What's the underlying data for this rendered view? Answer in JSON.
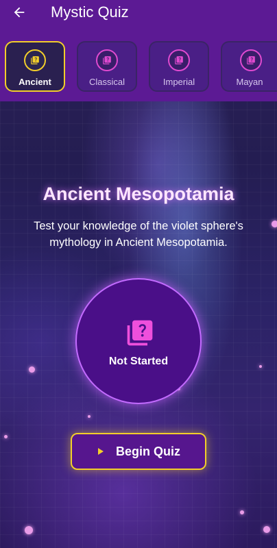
{
  "app": {
    "title": "Mystic Quiz"
  },
  "header": {
    "back_icon": "back-arrow-icon"
  },
  "tabs": [
    {
      "label": "Ancient",
      "icon": "quiz-icon",
      "active": true
    },
    {
      "label": "Classical",
      "icon": "quiz-icon",
      "active": false
    },
    {
      "label": "Imperial",
      "icon": "quiz-icon",
      "active": false
    },
    {
      "label": "Mayan",
      "icon": "quiz-icon",
      "active": false
    }
  ],
  "main": {
    "title": "Ancient Mesopotamia",
    "description": "Test your knowledge of the violet sphere's mythology in Ancient Mesopotamia.",
    "status": "Not Started",
    "status_icon": "quiz-icon",
    "begin_label": "Begin Quiz",
    "begin_icon": "play-icon"
  },
  "colors": {
    "header": "#5c1a94",
    "accent_gold": "#f3cf2a",
    "accent_pink": "#e04ad0",
    "circle": "#4a0f88"
  }
}
